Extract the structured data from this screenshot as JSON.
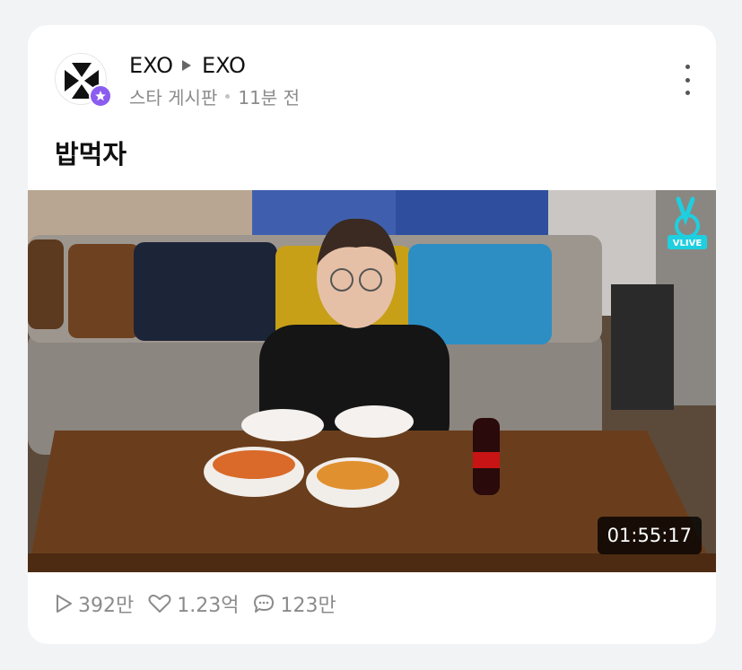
{
  "post": {
    "channel": "EXO",
    "board": "EXO",
    "category": "스타 게시판",
    "time": "11분 전",
    "title": "밥먹자",
    "video": {
      "duration": "01:55:17",
      "badge": "VLIVE"
    },
    "stats": {
      "plays": "392만",
      "likes": "1.23억",
      "comments": "123만"
    }
  },
  "icons": {
    "avatar": "exo-logo-icon",
    "badge": "star-badge-icon",
    "separator": "play-triangle-icon",
    "menu": "more-vertical-icon",
    "plays": "play-icon",
    "likes": "heart-icon",
    "comments": "comment-icon"
  },
  "colors": {
    "badge": "#8a5cf0",
    "vlive": "#1ecfe0",
    "meta_text": "#8b8b8b"
  }
}
